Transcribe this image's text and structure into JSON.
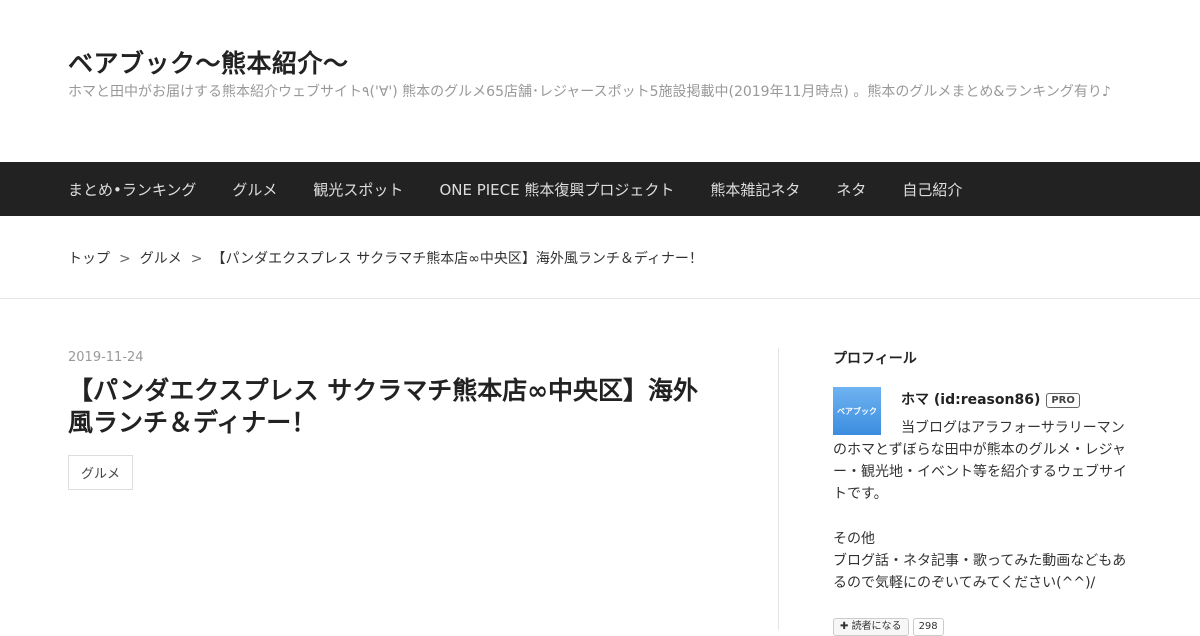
{
  "blog": {
    "title": "ベアブック～熊本紹介～",
    "description": "ホマと田中がお届けする熊本紹介ウェブサイト٩('∀') 熊本のグルメ65店舗･レジャースポット5施設掲載中(2019年11月時点) 。熊本のグルメまとめ&ランキング有り♪"
  },
  "nav": {
    "items": [
      "まとめ•ランキング",
      "グルメ",
      "観光スポット",
      "ONE PIECE 熊本復興プロジェクト",
      "熊本雑記ネタ",
      "ネタ",
      "自己紹介"
    ]
  },
  "breadcrumb": {
    "items": [
      "トップ",
      "グルメ",
      "【パンダエクスプレス サクラマチ熊本店∞中央区】海外風ランチ＆ディナー！"
    ],
    "separator": ">"
  },
  "entry": {
    "date": "2019-11-24",
    "title": "【パンダエクスプレス サクラマチ熊本店∞中央区】海外風ランチ＆ディナー！",
    "category": "グルメ"
  },
  "sidebar": {
    "heading": "プロフィール",
    "icon_text": "ベアブック",
    "name": "ホマ (id:reason86)",
    "badge": "PRO",
    "text1": "当ブログはアラフォーサラリーマンのホマとずぼらな田中が熊本のグルメ・レジャー・観光地・イベント等を紹介するウェブサイトです。",
    "other_title": "その他",
    "other_text": "ブログ話・ネタ記事・歌ってみた動画などもあるので気軽にのぞいてみてください(^^)/",
    "subscribe_label": "読者になる",
    "subscribe_count": "298"
  }
}
